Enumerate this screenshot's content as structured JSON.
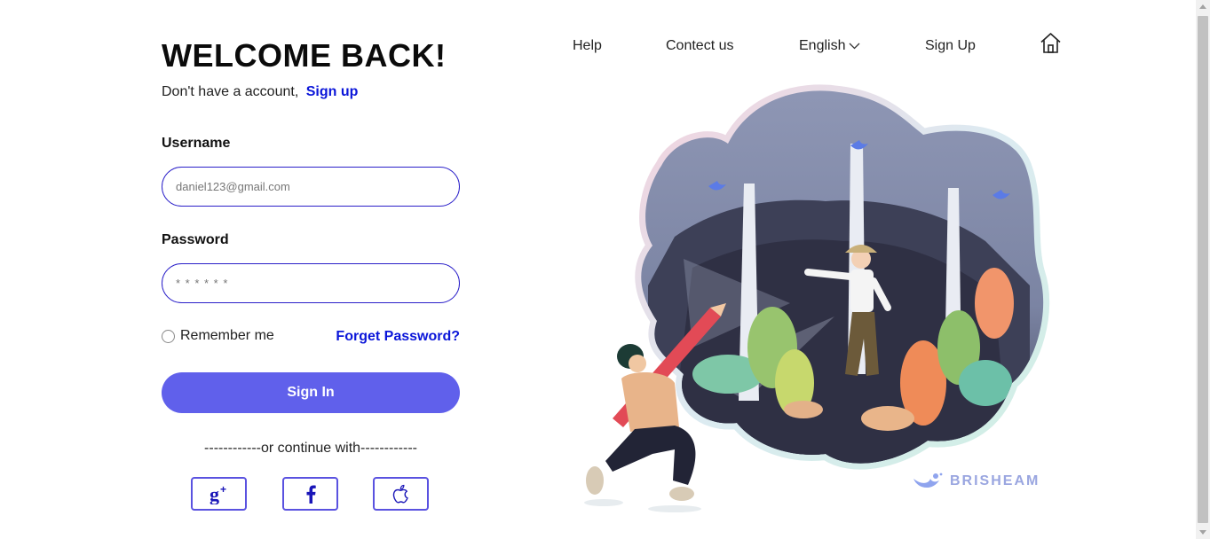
{
  "login": {
    "title": "WELCOME BACK!",
    "no_account_text": "Don't have a account,",
    "signup_link": "Sign up",
    "username_label": "Username",
    "username_placeholder": "daniel123@gmail.com",
    "password_label": "Password",
    "password_placeholder": "* * * * * *",
    "remember_label": "Remember me",
    "remember_checked": false,
    "forgot_label": "Forget Password?",
    "signin_label": "Sign In",
    "continue_text": "------------or continue with------------"
  },
  "social": [
    {
      "icon": "google-plus-icon"
    },
    {
      "icon": "facebook-icon"
    },
    {
      "icon": "apple-icon"
    }
  ],
  "nav": {
    "help": "Help",
    "contact": "Contect us",
    "language": "English",
    "signup": "Sign Up",
    "home_icon": "home-icon"
  },
  "brand": {
    "name": "BRISHEAM",
    "icon": "bird-icon",
    "color": "#9aa6e0"
  },
  "colors": {
    "accent": "#6060eb",
    "link": "#0b16d9",
    "input_border": "#2a1fc9"
  }
}
